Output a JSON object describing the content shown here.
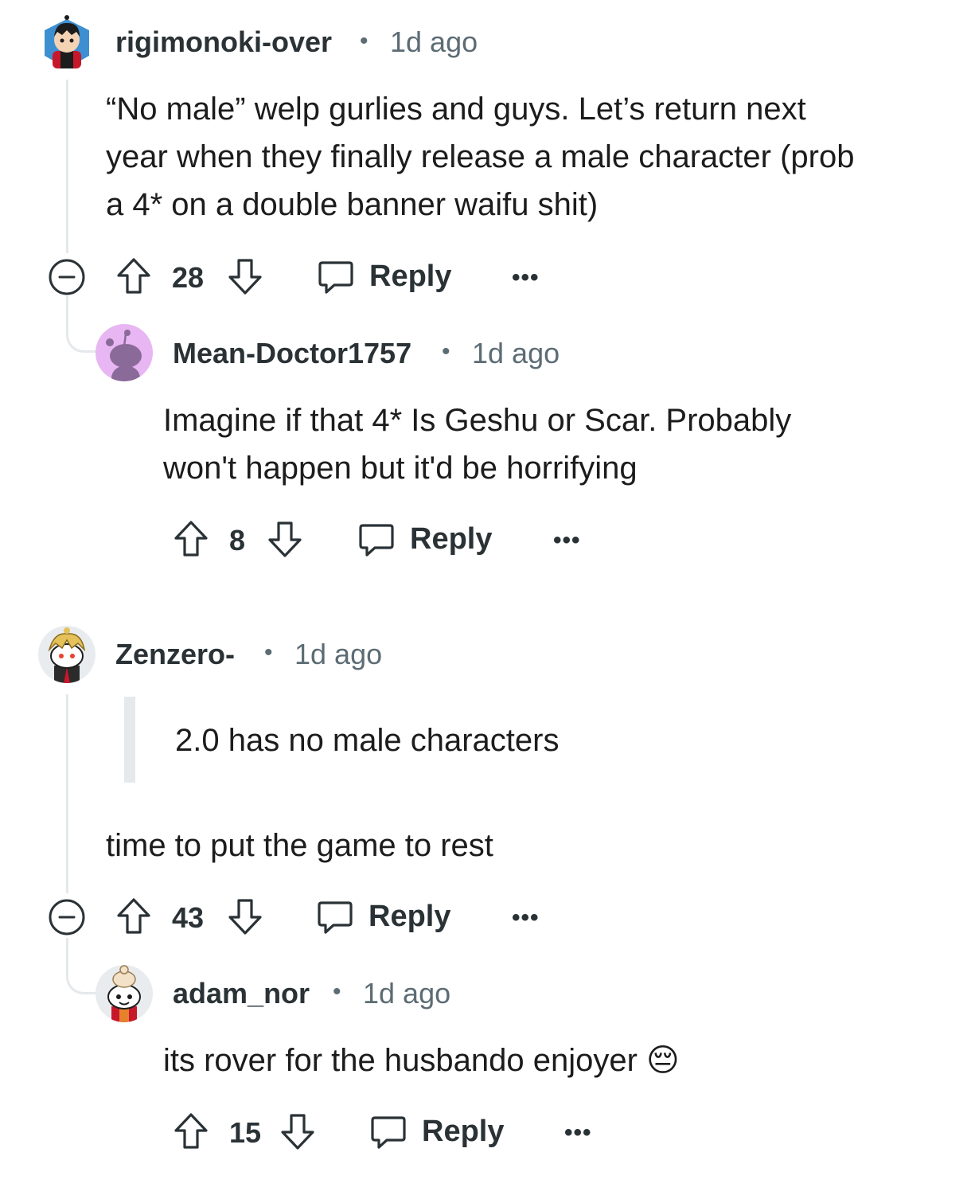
{
  "comments": [
    {
      "username": "rigimonoki-over",
      "separator": "•",
      "time": "1d ago",
      "body_lines": [
        "“No male” welp gurlies and guys. Let’s return next",
        "year when they finally release a male character (prob",
        "a 4* on a double banner waifu shit)"
      ],
      "votes": "28",
      "reply_label": "Reply",
      "more_label": "•••",
      "avatar_icon": "snoo-avatar-black-hair-red-scarf",
      "replies": [
        {
          "username": "Mean-Doctor1757",
          "separator": "•",
          "time": "1d ago",
          "body_lines": [
            "Imagine if that 4* Is Geshu or Scar. Probably",
            "won't happen but it'd be horrifying"
          ],
          "votes": "8",
          "reply_label": "Reply",
          "more_label": "•••",
          "avatar_icon": "default-snoo-avatar-purple"
        }
      ]
    },
    {
      "username": "Zenzero-",
      "separator": "•",
      "time": "1d ago",
      "quote": "2.0 has no male characters",
      "body_lines": [
        "time to put the game to rest"
      ],
      "votes": "43",
      "reply_label": "Reply",
      "more_label": "•••",
      "avatar_icon": "snoo-avatar-blonde-suit",
      "replies": [
        {
          "username": "adam_nor",
          "separator": "•",
          "time": "1d ago",
          "body_lines": [
            "its rover for the husbando enjoyer"
          ],
          "emoji": "😔",
          "votes": "15",
          "reply_label": "Reply",
          "more_label": "•••",
          "avatar_icon": "snoo-avatar-chef-hat-red-scarf"
        }
      ]
    }
  ],
  "colors": {
    "text_primary": "#1c1c1c",
    "text_meta": "#5c6c74",
    "thread_line": "#e5e9eb",
    "icon": "#2a3236"
  }
}
